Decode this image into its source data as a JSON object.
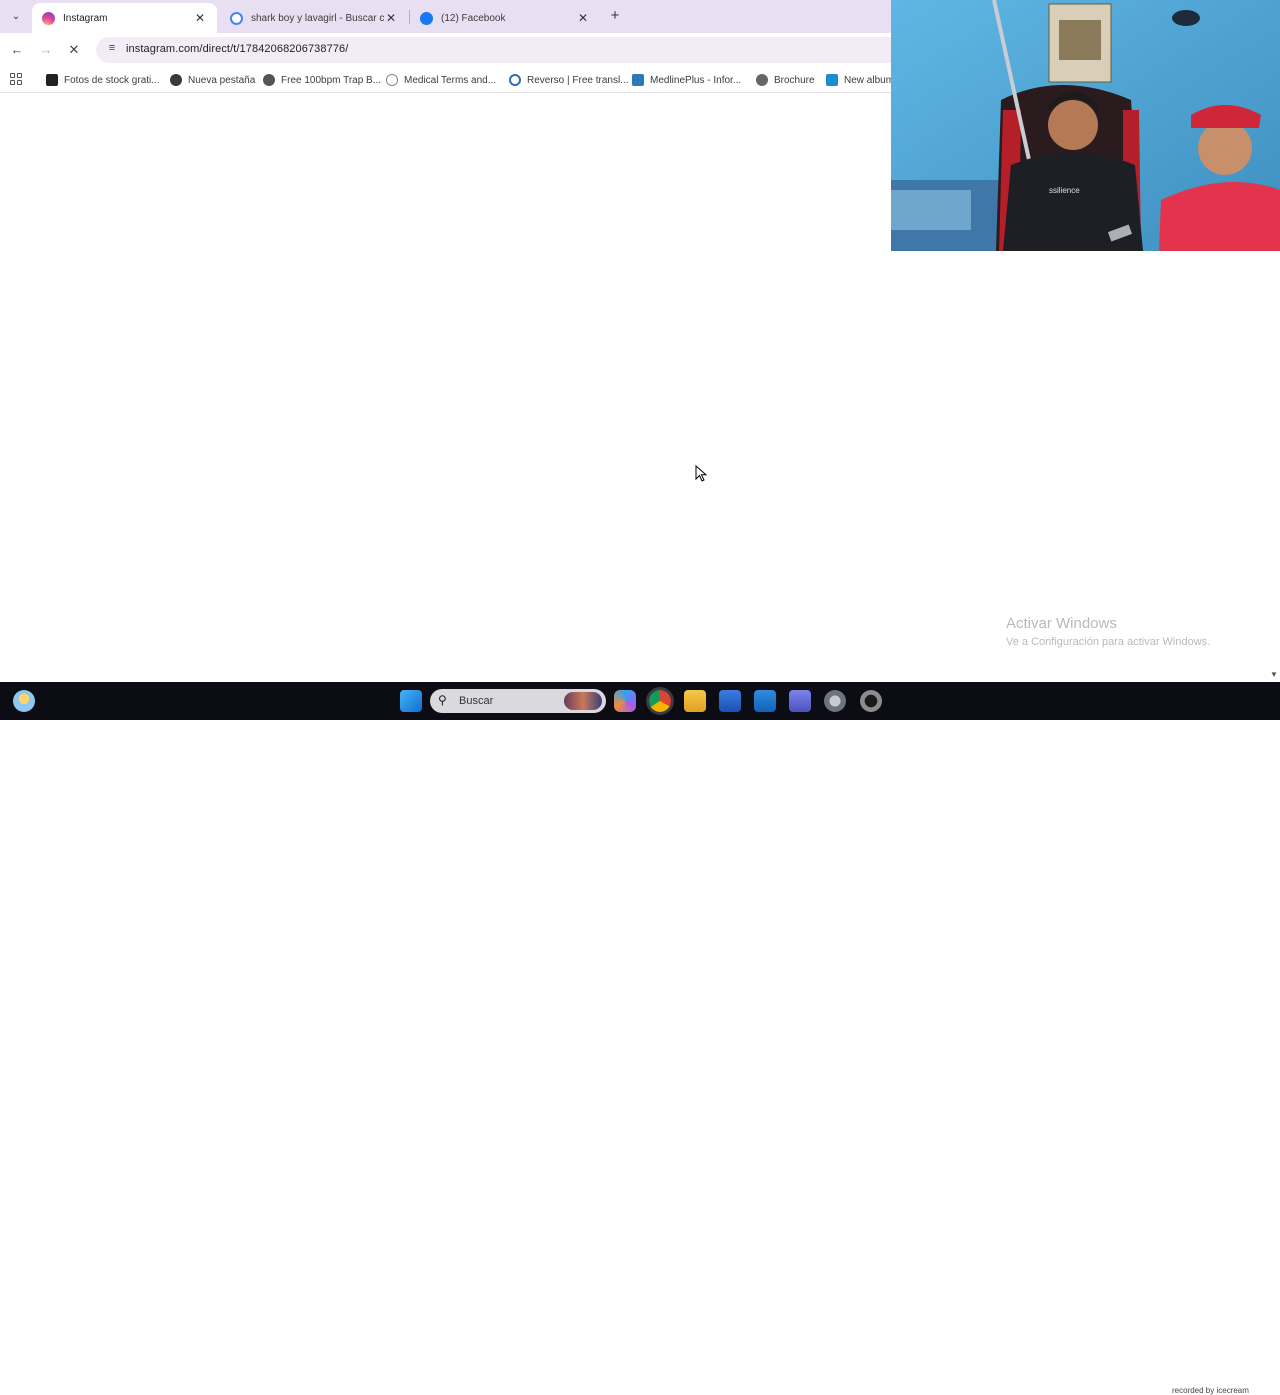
{
  "browser": {
    "tabs": [
      {
        "title": "Instagram",
        "active": true,
        "favicon": "instagram-icon",
        "color": "#d6306f"
      },
      {
        "title": "shark boy y lavagirl - Buscar co",
        "active": false,
        "favicon": "google-icon",
        "color": "#4285f4"
      },
      {
        "title": "(12) Facebook",
        "active": false,
        "favicon": "facebook-icon",
        "color": "#1877f2"
      }
    ],
    "new_tab_label": "+",
    "url": "instagram.com/direct/t/17842068206738776/",
    "bookmarks": [
      {
        "label": "Fotos de stock grati...",
        "icon": "photo-icon"
      },
      {
        "label": "Nueva pestaña",
        "icon": "chrome-icon"
      },
      {
        "label": "Free 100bpm Trap B...",
        "icon": "music-icon"
      },
      {
        "label": "Medical Terms and...",
        "icon": "globe-icon"
      },
      {
        "label": "Reverso | Free transl...",
        "icon": "reverso-icon"
      },
      {
        "label": "MedlinePlus - Infor...",
        "icon": "medline-icon"
      },
      {
        "label": "Brochure",
        "icon": "brochure-icon"
      },
      {
        "label": "New album",
        "icon": "album-icon"
      }
    ]
  },
  "overlay": {
    "activate_title": "Activar Windows",
    "activate_subtitle": "Ve a Configuración para activar Windows."
  },
  "taskbar": {
    "search_placeholder": "Buscar",
    "apps": [
      "weather-icon",
      "windows-start-icon",
      "copilot-icon",
      "chrome-icon",
      "file-explorer-icon",
      "store-icon",
      "mail-icon",
      "teams-icon",
      "settings-icon",
      "app-icon"
    ],
    "watermark": "recorded by icecream"
  },
  "colors": {
    "tabstrip": "#e9dff3",
    "omnibox": "#f1ecf6",
    "taskbar": "#0b0c14"
  }
}
